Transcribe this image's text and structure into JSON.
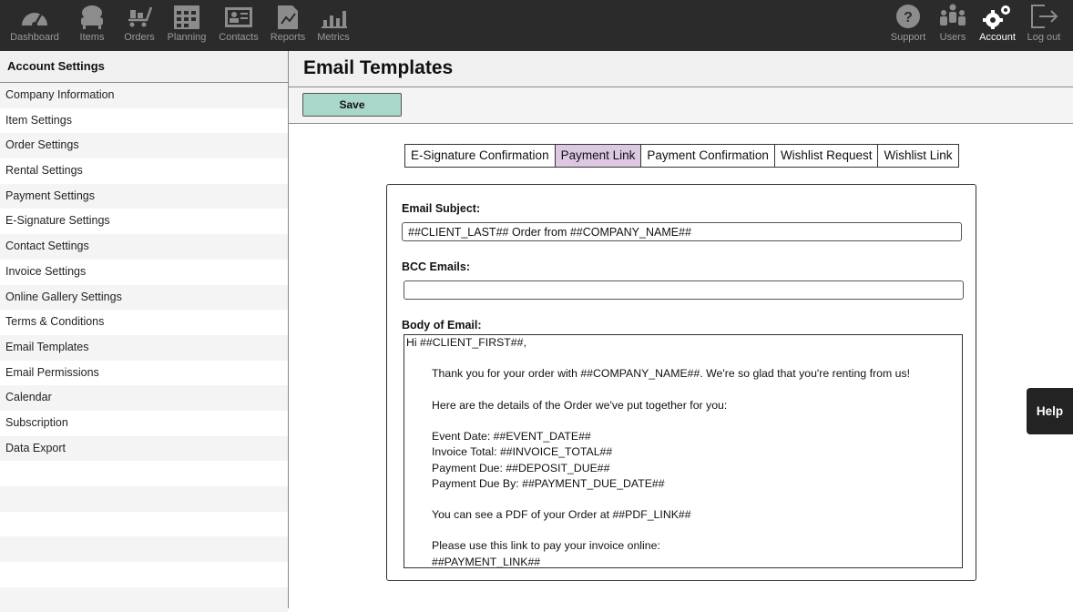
{
  "nav": {
    "left": [
      {
        "label": "Dashboard",
        "icon": "dashboard-icon"
      },
      {
        "label": "Items",
        "icon": "items-icon"
      },
      {
        "label": "Orders",
        "icon": "orders-icon"
      },
      {
        "label": "Planning",
        "icon": "planning-icon"
      },
      {
        "label": "Contacts",
        "icon": "contacts-icon"
      },
      {
        "label": "Reports",
        "icon": "reports-icon"
      },
      {
        "label": "Metrics",
        "icon": "metrics-icon"
      }
    ],
    "right": [
      {
        "label": "Support",
        "icon": "support-icon"
      },
      {
        "label": "Users",
        "icon": "users-icon"
      },
      {
        "label": "Account",
        "icon": "account-gears-icon",
        "active": true
      },
      {
        "label": "Log out",
        "icon": "logout-icon"
      }
    ]
  },
  "sidebar": {
    "title": "Account Settings",
    "items": [
      {
        "label": "Company Information"
      },
      {
        "label": "Item Settings"
      },
      {
        "label": "Order Settings"
      },
      {
        "label": "Rental Settings"
      },
      {
        "label": "Payment Settings"
      },
      {
        "label": "E-Signature Settings"
      },
      {
        "label": "Contact Settings"
      },
      {
        "label": "Invoice Settings"
      },
      {
        "label": "Online Gallery Settings"
      },
      {
        "label": "Terms & Conditions"
      },
      {
        "label": "Email Templates"
      },
      {
        "label": "Email Permissions"
      },
      {
        "label": "Calendar"
      },
      {
        "label": "Subscription"
      },
      {
        "label": "Data Export"
      }
    ]
  },
  "main": {
    "title": "Email Templates",
    "save_label": "Save",
    "tabs": [
      {
        "label": "E-Signature Confirmation"
      },
      {
        "label": "Payment Link",
        "active": true
      },
      {
        "label": "Payment Confirmation"
      },
      {
        "label": "Wishlist Request"
      },
      {
        "label": "Wishlist Link"
      }
    ],
    "form": {
      "subject_label": "Email Subject:",
      "subject_value": "##CLIENT_LAST## Order from ##COMPANY_NAME##",
      "bcc_label": "BCC  Emails:",
      "bcc_value": "",
      "body_label": "Body of Email:",
      "body_lines": [
        "Hi ##CLIENT_FIRST##,",
        "",
        "Thank you for your order with ##COMPANY_NAME##. We're so glad that you're renting from us!",
        "",
        "Here are the details of the Order we've put together for you:",
        "",
        "Event Date: ##EVENT_DATE##",
        "Invoice Total: ##INVOICE_TOTAL##",
        "Payment Due: ##DEPOSIT_DUE##",
        "Payment Due By: ##PAYMENT_DUE_DATE##",
        "",
        "You can see a PDF of your Order at ##PDF_LINK##",
        "",
        "Please use this link to pay your invoice online:",
        "##PAYMENT_LINK##"
      ]
    }
  },
  "help_label": "Help",
  "colors": {
    "nav_bg": "#2b2b2b",
    "save_bg": "#a9d8cb",
    "active_tab": "#dcc8e0"
  }
}
